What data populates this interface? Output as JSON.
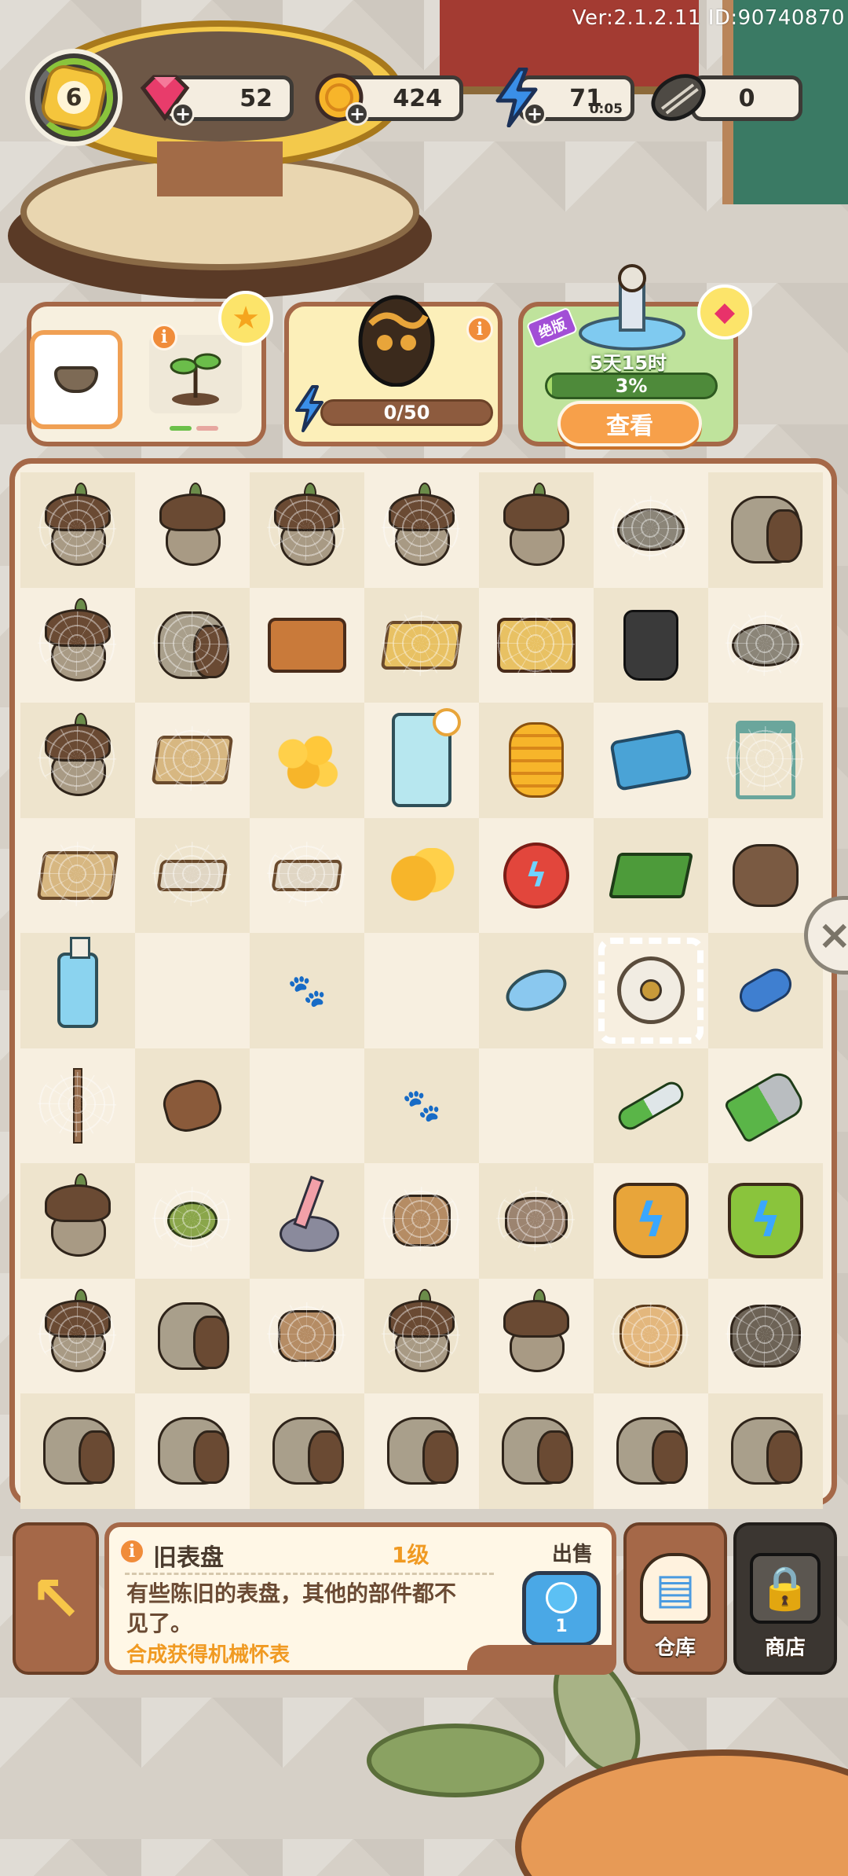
{
  "version": "Ver:2.1.2.11 ID:90740870",
  "top_bar": {
    "level": "6",
    "gems": "52",
    "coins": "424",
    "energy": "71",
    "energy_timer": "0:05",
    "seeds": "0",
    "plus": "+"
  },
  "cards": {
    "orders": {
      "info": "i"
    },
    "egg": {
      "info": "i",
      "progress_text": "0/50",
      "progress": 0.0
    },
    "event": {
      "limited_label": "绝版",
      "time_left": "5天15时",
      "progress_text": "3%",
      "progress": 0.03,
      "view_button": "查看"
    }
  },
  "board": {
    "rows": [
      [
        "acorn-web",
        "acorn",
        "acorn-web",
        "acorn-web",
        "acorn",
        "rock-web",
        "sack"
      ],
      [
        "acorn-web",
        "sack-web",
        "toolbox",
        "crate-gold-web",
        "toolbox-gold-web",
        "boots",
        "rock-web"
      ],
      [
        "acorn-web",
        "crate-web",
        "coins-pile",
        "fridge",
        "coin-stack",
        "seed-card",
        "chair-web"
      ],
      [
        "crate-web",
        "bone-web",
        "bone-web",
        "two-coins",
        "energy-orb",
        "cart",
        "gloves"
      ],
      [
        "soap-bottle",
        "empty",
        "paw",
        "empty",
        "soap-bar",
        "dial",
        "screw"
      ],
      [
        "branch-web",
        "glove",
        "empty",
        "paw",
        "empty",
        "knife",
        "axe"
      ],
      [
        "acorn",
        "pod-web",
        "plunger",
        "cheese-web",
        "fish-web",
        "energy-basket",
        "energy-basket-green"
      ],
      [
        "acorn-web",
        "sack",
        "cheese-web",
        "acorn-web",
        "acorn",
        "pouch-web",
        "rock-stack-web"
      ],
      [
        "sack",
        "sack",
        "sack",
        "sack",
        "sack",
        "sack",
        "sack"
      ]
    ],
    "selected": [
      4,
      5
    ]
  },
  "side_close_icon": "×",
  "back_icon": "↖",
  "info": {
    "icon": "i",
    "title": "旧表盘",
    "level": "1级",
    "desc": "有些陈旧的表盘，其他的部件都不见了。",
    "hint": "合成获得机械怀表",
    "sell_label": "出售",
    "sell_price": "1"
  },
  "warehouse": {
    "label": "仓库"
  },
  "shop": {
    "label": "商店"
  },
  "colors": {
    "panel_border": "#a56848",
    "accent_orange": "#f09a22",
    "progress_green": "#a6d96a"
  }
}
